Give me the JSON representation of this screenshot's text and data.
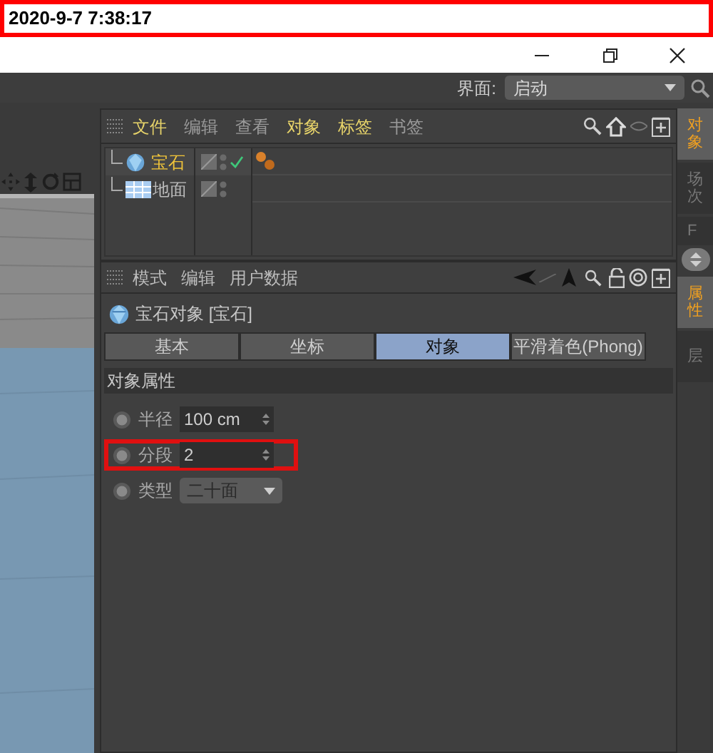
{
  "timestamp": "2020-9-7 7:38:17",
  "layout_selector": {
    "label": "界面:",
    "value": "启动"
  },
  "object_manager": {
    "menu": [
      {
        "label": "文件",
        "color": "#e8d46a"
      },
      {
        "label": "编辑",
        "color": "#9a9a9a"
      },
      {
        "label": "查看",
        "color": "#9a9a9a"
      },
      {
        "label": "对象",
        "color": "#e8d46a"
      },
      {
        "label": "标签",
        "color": "#e8d46a"
      },
      {
        "label": "书签",
        "color": "#9a9a9a"
      }
    ],
    "objects": [
      {
        "name": "宝石",
        "kind": "gem",
        "selected": true,
        "checked": true,
        "has_tag": true
      },
      {
        "name": "地面",
        "kind": "floor",
        "selected": false,
        "checked": false,
        "has_tag": false
      }
    ]
  },
  "attribute_manager": {
    "menu": [
      "模式",
      "编辑",
      "用户数据"
    ],
    "object_title": "宝石对象 [宝石]",
    "tabs": [
      {
        "label": "基本",
        "selected": false
      },
      {
        "label": "坐标",
        "selected": false
      },
      {
        "label": "对象",
        "selected": true
      },
      {
        "label": "平滑着色(Phong)",
        "selected": false
      }
    ],
    "section": "对象属性",
    "params": [
      {
        "label": "半径",
        "value": "100 cm",
        "kind": "number",
        "highlighted": false
      },
      {
        "label": "分段",
        "value": "2",
        "kind": "number",
        "highlighted": true
      },
      {
        "label": "类型",
        "value": "二十面",
        "kind": "dropdown",
        "highlighted": false
      }
    ]
  },
  "side_tabs_top": [
    {
      "label": "对象",
      "selected": true
    },
    {
      "label": "场次",
      "selected": false
    },
    {
      "label": "F",
      "selected": false
    }
  ],
  "side_tabs_bottom": [
    {
      "label": "属性",
      "selected": true
    },
    {
      "label": "层",
      "selected": false
    }
  ]
}
